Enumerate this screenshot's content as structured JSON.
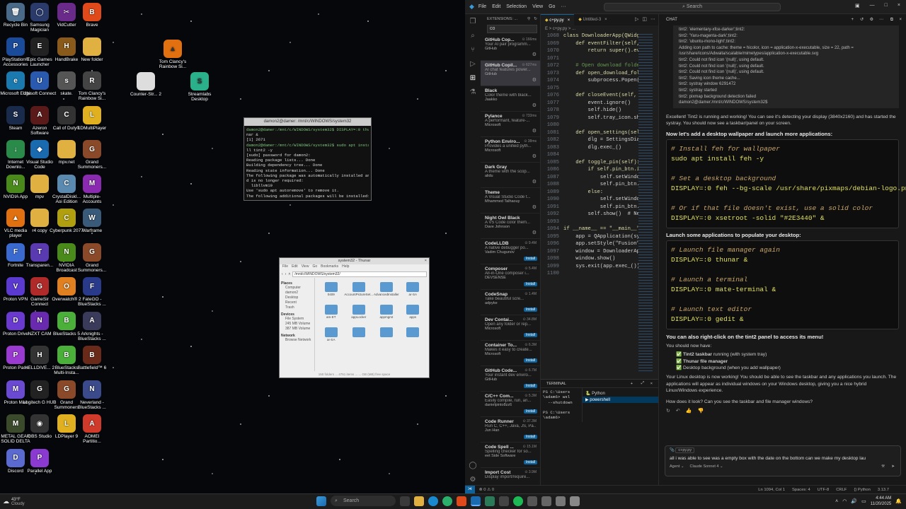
{
  "desktop": {
    "icons": [
      {
        "label": "Recycle Bin",
        "color": "#4a6a8a",
        "glyph": "🗑"
      },
      {
        "label": "Samsung Magician",
        "color": "#2a3a6a",
        "glyph": "◯"
      },
      {
        "label": "VidCutter",
        "color": "#6a2a8a",
        "glyph": "✂"
      },
      {
        "label": "Brave",
        "color": "#e04a1a",
        "glyph": "B"
      },
      {
        "label": "PlayStation® Accessories",
        "color": "#1a4a9a",
        "glyph": "P"
      },
      {
        "label": "Epic Games Launcher",
        "color": "#222",
        "glyph": "E"
      },
      {
        "label": "HandBrake",
        "color": "#8a5a1a",
        "glyph": "H"
      },
      {
        "label": "New folder",
        "color": "#e0b040",
        "glyph": ""
      },
      {
        "label": "Microsoft Edge",
        "color": "#1a7ab0",
        "glyph": "e"
      },
      {
        "label": "Ubisoft Connect",
        "color": "#2a5ab0",
        "glyph": "U"
      },
      {
        "label": "skate.",
        "color": "#555",
        "glyph": "s"
      },
      {
        "label": "Tom Clancy's Rainbow Si...",
        "color": "#444",
        "glyph": "R"
      },
      {
        "label": "Steam",
        "color": "#1a2a4a",
        "glyph": "S"
      },
      {
        "label": "Azeron Software",
        "color": "#5a1a1a",
        "glyph": "A"
      },
      {
        "label": "Call of Duty®",
        "color": "#333",
        "glyph": "C"
      },
      {
        "label": "LDMultiPlayer",
        "color": "#e0b020",
        "glyph": "L"
      },
      {
        "label": "Internet Downlo...",
        "color": "#2a8a4a",
        "glyph": "↓"
      },
      {
        "label": "Visual Studio Code",
        "color": "#1a6ab0",
        "glyph": "◆"
      },
      {
        "label": "mpv.net",
        "color": "#e0b040",
        "glyph": ""
      },
      {
        "label": "Grand Summoners...",
        "color": "#8a4a2a",
        "glyph": "G"
      },
      {
        "label": "NVIDIA App",
        "color": "#4a8a1a",
        "glyph": "N"
      },
      {
        "label": "mpv",
        "color": "#e0b040",
        "glyph": ""
      },
      {
        "label": "CrystalDiskI... Aoi Edition",
        "color": "#5a8ab0",
        "glyph": "C"
      },
      {
        "label": "Multiple-Accounts",
        "color": "#8a2ab0",
        "glyph": "M"
      },
      {
        "label": "VLC media player",
        "color": "#e07010",
        "glyph": "▲"
      },
      {
        "label": "r4 copy",
        "color": "#e0b040",
        "glyph": ""
      },
      {
        "label": "Cyberpunk 2077",
        "color": "#b0a010",
        "glyph": "C"
      },
      {
        "label": "Warframe",
        "color": "#3a5a7a",
        "glyph": "W"
      },
      {
        "label": "Fortnite",
        "color": "#3a6ad0",
        "glyph": "F"
      },
      {
        "label": "Transparen...",
        "color": "#5a3ab0",
        "glyph": "T"
      },
      {
        "label": "NVIDIA Broadcast",
        "color": "#4a8a1a",
        "glyph": "N"
      },
      {
        "label": "Grand Summoners...",
        "color": "#8a4a2a",
        "glyph": "G"
      },
      {
        "label": "Proton VPN",
        "color": "#5a3ad0",
        "glyph": "V"
      },
      {
        "label": "GameSir Connect",
        "color": "#b02a2a",
        "glyph": "G"
      },
      {
        "label": "Overwatch® 2",
        "color": "#e08020",
        "glyph": "O"
      },
      {
        "label": "FateGO - BlueStacks ...",
        "color": "#2a3a8a",
        "glyph": "F"
      },
      {
        "label": "Proton Drive",
        "color": "#6a3ad0",
        "glyph": "D"
      },
      {
        "label": "NZXT CAM",
        "color": "#6a2ab0",
        "glyph": "N"
      },
      {
        "label": "BlueStacks 5",
        "color": "#4ab03a",
        "glyph": "B"
      },
      {
        "label": "Arknights - BlueStacks ...",
        "color": "#3a3a5a",
        "glyph": "A"
      },
      {
        "label": "Proton Pass",
        "color": "#9a3ad0",
        "glyph": "P"
      },
      {
        "label": "HELLDIVE... 2",
        "color": "#333",
        "glyph": "H"
      },
      {
        "label": "BlueStacks Multi-Insta...",
        "color": "#4ab03a",
        "glyph": "B"
      },
      {
        "label": "Battlefield™ 6",
        "color": "#6a2a1a",
        "glyph": "B"
      },
      {
        "label": "Proton Mail",
        "color": "#6a4ad0",
        "glyph": "M"
      },
      {
        "label": "Logitech G HUB",
        "color": "#222",
        "glyph": "G"
      },
      {
        "label": "Grand Summoners",
        "color": "#8a4a2a",
        "glyph": "G"
      },
      {
        "label": "Neverland - BlueStacks ...",
        "color": "#3a4a8a",
        "glyph": "N"
      },
      {
        "label": "METAL GEAR SOLID DELTA",
        "color": "#3a4a2a",
        "glyph": "M"
      },
      {
        "label": "OBS Studio",
        "color": "#333",
        "glyph": "◉"
      },
      {
        "label": "LDPlayer 9",
        "color": "#e0b020",
        "glyph": "L"
      },
      {
        "label": "AOMEI Partitio...",
        "color": "#d03a2a",
        "glyph": "A"
      },
      {
        "label": "Discord",
        "color": "#5a6ad0",
        "glyph": "D"
      },
      {
        "label": "Parallel App",
        "color": "#8a3ad0",
        "glyph": "P"
      }
    ],
    "extra_icons": [
      {
        "label": "Tom Clancy's Rainbow Si...",
        "color": "#e07010",
        "glyph": "▲"
      },
      {
        "label": "Counter-Str... 2",
        "color": "#ddd",
        "glyph": ""
      },
      {
        "label": "Streamlabs Desktop",
        "color": "#2ab08a",
        "glyph": "S"
      }
    ]
  },
  "terminal_window": {
    "title": "damon2@damer: /mnt/c/WINDOWS/system32",
    "lines": [
      "damon2@damer:/mnt/c/WINDOWS/system32$ DISPLAY=:0 thu",
      "nar &",
      "[1] 2671",
      "damon2@damer:/mnt/c/WINDOWS/system32$ sudo apt insta",
      "ll tint2 -y",
      "[sudo] password for damon2:",
      "Reading package lists... Done",
      "Building dependency tree... Done",
      "Reading state information... Done",
      "The following package was automatically installed an",
      "d is no longer required:",
      "  libllvm19",
      "Use 'sudo apt autoremove' to remove it.",
      "The following additional packages will be installed:"
    ]
  },
  "thunar_window": {
    "title": "system32 - Thunar",
    "menu": [
      "File",
      "Edit",
      "View",
      "Go",
      "Bookmarks",
      "Help"
    ],
    "path": "/mnt/c/WINDOWS/system32/",
    "sections": [
      {
        "name": "Places",
        "items": [
          "Computer",
          "damon2",
          "Desktop",
          "Recent",
          "Trash"
        ]
      },
      {
        "name": "Devices",
        "items": [
          "File System",
          "245 MB Volume",
          "387 MB Volume"
        ]
      },
      {
        "name": "Network",
        "items": [
          "Browse Network"
        ]
      }
    ],
    "folders": [
      "0409",
      "AccountPictureSet...",
      "AdvancedInstaller",
      "ar-SA",
      "am-ET",
      "appLocker",
      "appmgmt",
      "apps",
      "ar-SA",
      "",
      "",
      ""
    ],
    "status": "150 folders ... 4751 items ... ... GB (MB) free space"
  },
  "vscode": {
    "menu": [
      "File",
      "Edit",
      "Selection",
      "View",
      "Go"
    ],
    "menu_more": "···",
    "search": "Search",
    "extensions": {
      "header": "EXTENSIONS: ...",
      "query": "co",
      "items": [
        {
          "name": "GitHub Cop...",
          "desc": "Your AI pair programm...",
          "pub": "GitHub",
          "meta": "⊙ 166ms",
          "btn": "gear"
        },
        {
          "name": "GitHub Copil...",
          "desc": "AI chat features power...",
          "pub": "GitHub",
          "meta": "⊙ 627ms",
          "btn": "gear"
        },
        {
          "name": "Black",
          "desc": "Color theme with black...",
          "pub": "Jaakko",
          "meta": "",
          "btn": "gear"
        },
        {
          "name": "Pylance",
          "desc": "A performant, feature-...",
          "pub": "Microsoft",
          "meta": "⊙ 733ms",
          "btn": "gear"
        },
        {
          "name": "Python Enviro...",
          "desc": "Provides a unified pyth...",
          "pub": "Microsoft",
          "meta": "⊙ 38ms",
          "btn": "gear"
        },
        {
          "name": "Dark Gray",
          "desc": "A theme with the scop...",
          "pub": "alidu",
          "meta": "",
          "btn": "gear"
        },
        {
          "name": "Theme",
          "desc": "A Visual Studio Code t...",
          "pub": "Mhammed Talhaouy",
          "meta": "",
          "btn": "gear"
        },
        {
          "name": "Night Owl Black",
          "desc": "A VS Code color them...",
          "pub": "Dave Johnson",
          "meta": "",
          "btn": "gear"
        },
        {
          "name": "CodeLLDB",
          "desc": "A native debugger po...",
          "pub": "Vadim Chugunov",
          "meta": "⊙ 9.4M",
          "btn": "Install"
        },
        {
          "name": "Composer",
          "desc": "All-in-One composer i...",
          "pub": "DEVSENSE",
          "meta": "⊙ 5.4M",
          "btn": "Install"
        },
        {
          "name": "CodeSnap",
          "desc": "Take beautiful scre...",
          "pub": "adpyke",
          "meta": "⊙ 1.4M",
          "btn": "Install"
        },
        {
          "name": "Dev Contai...",
          "desc": "Open any folder or rep...",
          "pub": "Microsoft",
          "meta": "⊙ 34.8M",
          "btn": "Install"
        },
        {
          "name": "Container To...",
          "desc": "Makes it easy to create...",
          "pub": "Microsoft",
          "meta": "⊙ 6.3M",
          "btn": "Install"
        },
        {
          "name": "GitHub Code...",
          "desc": "Your instant dev enviro...",
          "pub": "GitHub",
          "meta": "⊙ 6.7M",
          "btn": "Install"
        },
        {
          "name": "C/C++ Com...",
          "desc": "Easily compile, run, an...",
          "pub": "danielpinto8zz6",
          "meta": "⊙ 5.3M",
          "btn": "Install"
        },
        {
          "name": "Code Runner",
          "desc": "Run C, C++, Java, JS, Pa...",
          "pub": "Jun Han",
          "meta": "⊙ 37.3M",
          "btn": "Install"
        },
        {
          "name": "Code Spell ...",
          "desc": "Spelling checker for so...",
          "pub": "eet Side Software",
          "meta": "⊙ 15.1M",
          "btn": "Install"
        },
        {
          "name": "Import Cost",
          "desc": "Display import/require...",
          "pub": "",
          "meta": "⊙ 3.9M",
          "btn": ""
        }
      ]
    },
    "tabs": [
      {
        "label": "c+py.py",
        "active": true
      },
      {
        "label": "Untitled-3",
        "active": false
      }
    ],
    "breadcrumb": "E > c+py.py > ...",
    "code": [
      {
        "n": "1068",
        "t": "class DownloaderApp(QWidget)"
      },
      {
        "n": "1069",
        "t": "    def eventFilter(self, so"
      },
      {
        "n": "1070",
        "t": "        return super().event"
      },
      {
        "n": "1071",
        "t": ""
      },
      {
        "n": "1072",
        "t": "    # Open download folder i"
      },
      {
        "n": "1073",
        "t": "    def open_download_folder"
      },
      {
        "n": "1074",
        "t": "        subprocess.Popen(f'e"
      },
      {
        "n": "1075",
        "t": ""
      },
      {
        "n": "1076",
        "t": "    def closeEvent(self, eve"
      },
      {
        "n": "1077",
        "t": "        event.ignore()"
      },
      {
        "n": "1078",
        "t": "        self.hide()"
      },
      {
        "n": "1079",
        "t": "        self.tray_icon.showM"
      },
      {
        "n": "1080",
        "t": ""
      },
      {
        "n": "1081",
        "t": "    def open_settings(self):"
      },
      {
        "n": "1082",
        "t": "        dlg = SettingsDialog"
      },
      {
        "n": "1083",
        "t": "        dlg.exec_()"
      },
      {
        "n": "1084",
        "t": ""
      },
      {
        "n": "1085",
        "t": "    def toggle_pin(self):"
      },
      {
        "n": "1086",
        "t": "        if self.pin_btn.isCh"
      },
      {
        "n": "1087",
        "t": "            self.setWindowFl"
      },
      {
        "n": "1088",
        "t": "            self.pin_btn.set"
      },
      {
        "n": "1089",
        "t": "        else:"
      },
      {
        "n": "1090",
        "t": "            self.setWindowFl"
      },
      {
        "n": "1091",
        "t": "            self.pin_btn.set"
      },
      {
        "n": "1092",
        "t": "        self.show()  # Neede"
      },
      {
        "n": "1093",
        "t": ""
      },
      {
        "n": "1094",
        "t": "if __name__ == \"__main__\":"
      },
      {
        "n": "1095",
        "t": "    app = QApplication(sys.a"
      },
      {
        "n": "1096",
        "t": "    app.setStyle(\"Fusion\")"
      },
      {
        "n": "1097",
        "t": "    window = DownloaderApp()"
      },
      {
        "n": "1098",
        "t": "    window.show()"
      },
      {
        "n": "1099",
        "t": "    sys.exit(app.exec_())"
      },
      {
        "n": "1100",
        "t": ""
      }
    ],
    "terminal": {
      "tab": "TERMINAL",
      "lines": [
        "PS C:\\Users",
        "\\adam6> wsl",
        "  --shutdown",
        "",
        "PS C:\\Users",
        "\\adam6>"
      ],
      "sessions": [
        "Python",
        "powershell"
      ]
    },
    "chat": {
      "tab": "CHAT",
      "log": [
        "tint2: 'elementary-xfce-darker';tint2:",
        "tint2: 'Yaru-magenta-dark';tint2:",
        "tint2: 'ubuntu-mono-light';tint2:",
        "Adding icon path to cache: theme = hicolor, icon = application-x-executable, size = 22, path =",
        "/usr/share/icons/Adwaita/scalable/mimetypes/application-x-executable.svg",
        "tint2: Could not find icon '(null)', using default.",
        "tint2: Could not find icon '(null)', using default.",
        "tint2: Could not find icon '(null)', using default.",
        "tint2: Saving icon theme cache...",
        "tint2: systray window 6291472",
        "tint2: systray started",
        "tint2: pixmap background detection failed",
        "damon2@damer:/mnt/c/WINDOWS/system32$"
      ],
      "p1": "Excellent! Tint2 is running and working! You can see it's detecting your display (3840x2160) and has started the systray. You should now see a taskbar/panel on your screen.",
      "h1": "Now let's add a desktop wallpaper and launch more applications:",
      "code1": [
        {
          "c": "# Install feh for wallpaper",
          "k": "comment"
        },
        {
          "c": "sudo apt install feh -y",
          "k": "cmd"
        },
        {
          "c": "",
          "k": "blank"
        },
        {
          "c": "# Set a desktop background",
          "k": "comment"
        },
        {
          "c": "DISPLAY=:0 feh --bg-scale /usr/share/pixmaps/debian-logo.pn",
          "k": "cmd"
        },
        {
          "c": "",
          "k": "blank"
        },
        {
          "c": "# Or if that file doesn't exist, use a solid color",
          "k": "comment"
        },
        {
          "c": "DISPLAY=:0 xsetroot -solid \"#2E3440\" &",
          "k": "cmd"
        }
      ],
      "h2": "Launch some applications to populate your desktop:",
      "code2": [
        {
          "c": "# Launch file manager again",
          "k": "comment"
        },
        {
          "c": "DISPLAY=:0 thunar &",
          "k": "cmd"
        },
        {
          "c": "",
          "k": "blank"
        },
        {
          "c": "# Launch a terminal",
          "k": "comment"
        },
        {
          "c": "DISPLAY=:0 mate-terminal &",
          "k": "cmd"
        },
        {
          "c": "",
          "k": "blank"
        },
        {
          "c": "# Launch text editor",
          "k": "comment"
        },
        {
          "c": "DISPLAY=:0 gedit &",
          "k": "cmd"
        }
      ],
      "h3": "You can also right-click on the tint2 panel to access its menu!",
      "p2": "You should now have:",
      "bullets": [
        {
          "b": "Tint2 taskbar",
          "r": " running (with system tray)"
        },
        {
          "b": "Thunar file manager",
          "r": ""
        },
        {
          "b": "",
          "r": "Desktop background (when you add wallpaper)"
        }
      ],
      "p3": "Your Linux desktop is now working! You should be able to see the taskbar and any applications you launch. The applications will appear as individual windows on your Windows desktop, giving you a nice hybrid Linux/Windows experience.",
      "p4": "How does it look? Can you see the taskbar and file manager windows?",
      "attach": "c+py.py",
      "input": "all i was able to see was a empty box with the date on the bottom can we make my desktop lau",
      "agent": "Agent ⌄",
      "model": "Claude Sonnet 4 ⌄"
    },
    "status": {
      "left": "⊗ 0 ⚠ 0",
      "items": [
        "Ln 1094, Col 1",
        "Spaces: 4",
        "UTF-8",
        "CRLF",
        "{} Python",
        "3.13.7"
      ]
    }
  },
  "taskbar": {
    "weather_temp": "43°F",
    "weather_desc": "Cloudy",
    "search": "Search",
    "time": "4:44 AM",
    "date": "11/20/2025"
  }
}
